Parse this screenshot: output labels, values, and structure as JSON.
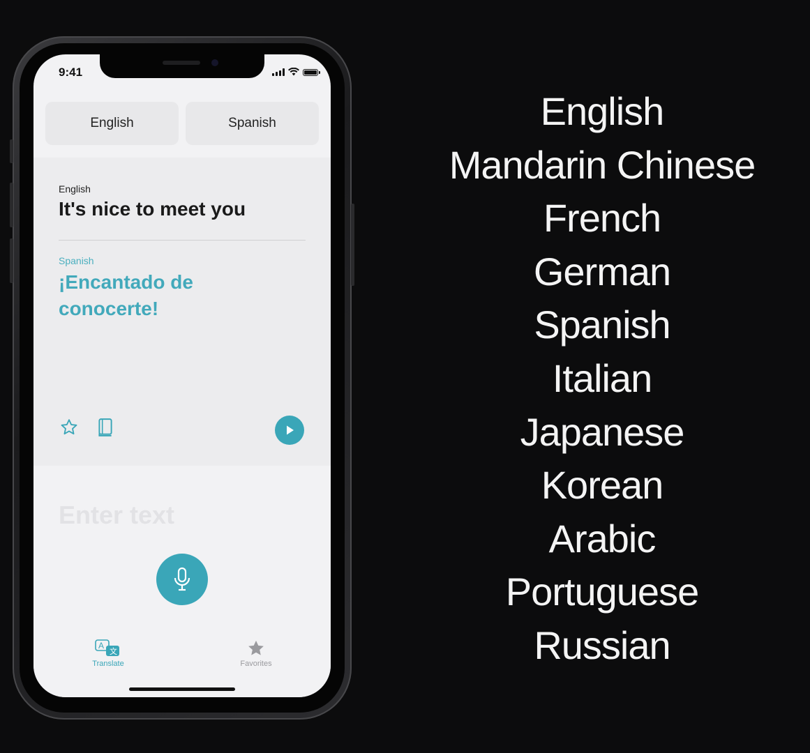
{
  "phone": {
    "status_bar": {
      "time": "9:41"
    },
    "language_bar": {
      "source_label": "English",
      "target_label": "Spanish"
    },
    "translation_card": {
      "source_language": "English",
      "source_text": "It's nice to meet you",
      "target_language": "Spanish",
      "target_text": "¡Encantado de conocerte!",
      "actions": [
        "star-icon",
        "dictionary-icon",
        "play-icon"
      ]
    },
    "input": {
      "placeholder": "Enter text",
      "mic_icon": "microphone-icon"
    },
    "tab_bar": {
      "tabs": [
        {
          "label": "Translate",
          "icon": "translate-icon",
          "active": true
        },
        {
          "label": "Favorites",
          "icon": "star-filled-icon",
          "active": false
        }
      ]
    }
  },
  "languages": [
    "English",
    "Mandarin Chinese",
    "French",
    "German",
    "Spanish",
    "Italian",
    "Japanese",
    "Korean",
    "Arabic",
    "Portuguese",
    "Russian"
  ],
  "colors": {
    "background": "#0c0c0d",
    "accent": "#3aa6b8",
    "screen": "#f2f2f4",
    "list_text": "#f4f4f4"
  }
}
